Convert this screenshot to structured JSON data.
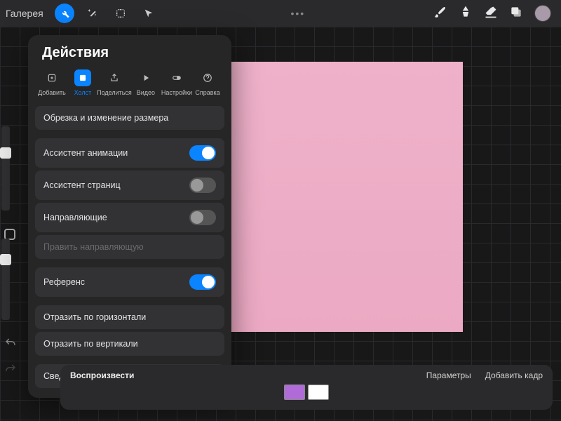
{
  "topbar": {
    "gallery": "Галерея",
    "dots": "•••"
  },
  "panel": {
    "title": "Действия",
    "tabs": [
      {
        "label": "Добавить"
      },
      {
        "label": "Холст"
      },
      {
        "label": "Поделиться"
      },
      {
        "label": "Видео"
      },
      {
        "label": "Настройки"
      },
      {
        "label": "Справка"
      }
    ],
    "rows": {
      "crop": "Обрезка и изменение размера",
      "anim_assist": "Ассистент анимации",
      "page_assist": "Ассистент страниц",
      "guides": "Направляющие",
      "edit_guide": "Править направляющую",
      "reference": "Референс",
      "flip_h": "Отразить по горизонтали",
      "flip_v": "Отразить по вертикали",
      "canvas_info": "Сведения о холсте"
    },
    "toggles": {
      "anim_assist": true,
      "page_assist": false,
      "guides": false,
      "reference": true
    }
  },
  "animbar": {
    "play": "Воспроизвести",
    "params": "Параметры",
    "add_frame": "Добавить кадр"
  },
  "colors": {
    "accent": "#0a84ff",
    "canvas": "#eeb1c9",
    "frame1": "#b06bd8",
    "frame2": "#ffffff"
  }
}
